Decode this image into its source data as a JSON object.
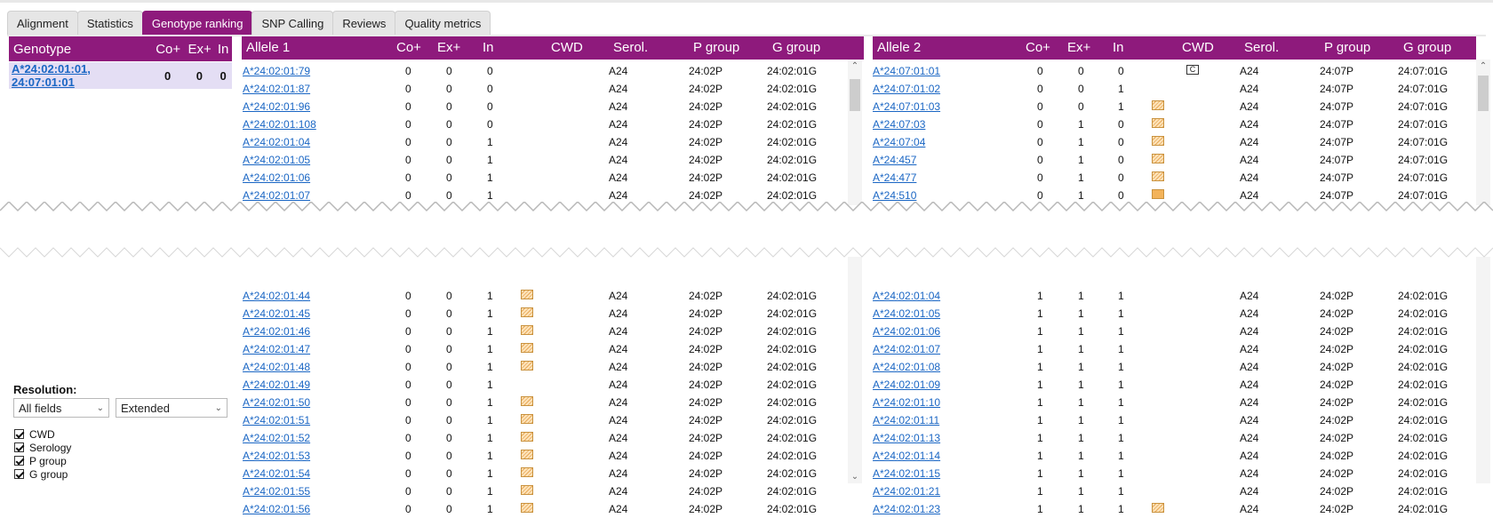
{
  "tabs": [
    "Alignment",
    "Statistics",
    "Genotype ranking",
    "SNP Calling",
    "Reviews",
    "Quality metrics"
  ],
  "active_tab": "Genotype ranking",
  "genotype_panel": {
    "headers": [
      "Genotype",
      "Co+",
      "Ex+",
      "In"
    ],
    "row": {
      "genotype": "A*24:02:01:01, 24:07:01:01",
      "co": "0",
      "ex": "0",
      "in": "0"
    }
  },
  "resolution": {
    "label": "Resolution:",
    "fields_select": "All fields",
    "mode_select": "Extended",
    "checkboxes": [
      "CWD",
      "Serology",
      "P group",
      "G group"
    ]
  },
  "allele1": {
    "headers": [
      "Allele 1",
      "Co+",
      "Ex+",
      "In",
      "CWD",
      "Serol.",
      "P group",
      "G group"
    ],
    "rows_top": [
      {
        "allele": "A*24:02:01:79",
        "co": "0",
        "ex": "0",
        "in": "0",
        "cwd": "",
        "serol": "A24",
        "p": "24:02P",
        "g": "24:02:01G"
      },
      {
        "allele": "A*24:02:01:87",
        "co": "0",
        "ex": "0",
        "in": "0",
        "cwd": "",
        "serol": "A24",
        "p": "24:02P",
        "g": "24:02:01G"
      },
      {
        "allele": "A*24:02:01:96",
        "co": "0",
        "ex": "0",
        "in": "0",
        "cwd": "",
        "serol": "A24",
        "p": "24:02P",
        "g": "24:02:01G"
      },
      {
        "allele": "A*24:02:01:108",
        "co": "0",
        "ex": "0",
        "in": "0",
        "cwd": "",
        "serol": "A24",
        "p": "24:02P",
        "g": "24:02:01G"
      },
      {
        "allele": "A*24:02:01:04",
        "co": "0",
        "ex": "0",
        "in": "1",
        "cwd": "",
        "serol": "A24",
        "p": "24:02P",
        "g": "24:02:01G"
      },
      {
        "allele": "A*24:02:01:05",
        "co": "0",
        "ex": "0",
        "in": "1",
        "cwd": "",
        "serol": "A24",
        "p": "24:02P",
        "g": "24:02:01G"
      },
      {
        "allele": "A*24:02:01:06",
        "co": "0",
        "ex": "0",
        "in": "1",
        "cwd": "",
        "serol": "A24",
        "p": "24:02P",
        "g": "24:02:01G"
      },
      {
        "allele": "A*24:02:01:07",
        "co": "0",
        "ex": "0",
        "in": "1",
        "cwd": "",
        "serol": "A24",
        "p": "24:02P",
        "g": "24:02:01G"
      }
    ],
    "rows_bottom": [
      {
        "allele": "A*24:02:01:44",
        "co": "0",
        "ex": "0",
        "in": "1",
        "cwd": "hatch",
        "serol": "A24",
        "p": "24:02P",
        "g": "24:02:01G"
      },
      {
        "allele": "A*24:02:01:45",
        "co": "0",
        "ex": "0",
        "in": "1",
        "cwd": "hatch",
        "serol": "A24",
        "p": "24:02P",
        "g": "24:02:01G"
      },
      {
        "allele": "A*24:02:01:46",
        "co": "0",
        "ex": "0",
        "in": "1",
        "cwd": "hatch",
        "serol": "A24",
        "p": "24:02P",
        "g": "24:02:01G"
      },
      {
        "allele": "A*24:02:01:47",
        "co": "0",
        "ex": "0",
        "in": "1",
        "cwd": "hatch",
        "serol": "A24",
        "p": "24:02P",
        "g": "24:02:01G"
      },
      {
        "allele": "A*24:02:01:48",
        "co": "0",
        "ex": "0",
        "in": "1",
        "cwd": "hatch",
        "serol": "A24",
        "p": "24:02P",
        "g": "24:02:01G"
      },
      {
        "allele": "A*24:02:01:49",
        "co": "0",
        "ex": "0",
        "in": "1",
        "cwd": "",
        "serol": "A24",
        "p": "24:02P",
        "g": "24:02:01G"
      },
      {
        "allele": "A*24:02:01:50",
        "co": "0",
        "ex": "0",
        "in": "1",
        "cwd": "hatch",
        "serol": "A24",
        "p": "24:02P",
        "g": "24:02:01G"
      },
      {
        "allele": "A*24:02:01:51",
        "co": "0",
        "ex": "0",
        "in": "1",
        "cwd": "hatch",
        "serol": "A24",
        "p": "24:02P",
        "g": "24:02:01G"
      },
      {
        "allele": "A*24:02:01:52",
        "co": "0",
        "ex": "0",
        "in": "1",
        "cwd": "hatch",
        "serol": "A24",
        "p": "24:02P",
        "g": "24:02:01G"
      },
      {
        "allele": "A*24:02:01:53",
        "co": "0",
        "ex": "0",
        "in": "1",
        "cwd": "hatch",
        "serol": "A24",
        "p": "24:02P",
        "g": "24:02:01G"
      },
      {
        "allele": "A*24:02:01:54",
        "co": "0",
        "ex": "0",
        "in": "1",
        "cwd": "hatch",
        "serol": "A24",
        "p": "24:02P",
        "g": "24:02:01G"
      },
      {
        "allele": "A*24:02:01:55",
        "co": "0",
        "ex": "0",
        "in": "1",
        "cwd": "hatch",
        "serol": "A24",
        "p": "24:02P",
        "g": "24:02:01G"
      },
      {
        "allele": "A*24:02:01:56",
        "co": "0",
        "ex": "0",
        "in": "1",
        "cwd": "hatch",
        "serol": "A24",
        "p": "24:02P",
        "g": "24:02:01G"
      }
    ]
  },
  "allele2": {
    "headers": [
      "Allele 2",
      "Co+",
      "Ex+",
      "In",
      "CWD",
      "Serol.",
      "P group",
      "G group"
    ],
    "rows_top": [
      {
        "allele": "A*24:07:01:01",
        "co": "0",
        "ex": "0",
        "in": "0",
        "cwd": "badge",
        "serol": "A24",
        "p": "24:07P",
        "g": "24:07:01G"
      },
      {
        "allele": "A*24:07:01:02",
        "co": "0",
        "ex": "0",
        "in": "1",
        "cwd": "",
        "serol": "A24",
        "p": "24:07P",
        "g": "24:07:01G"
      },
      {
        "allele": "A*24:07:01:03",
        "co": "0",
        "ex": "0",
        "in": "1",
        "cwd": "hatch",
        "serol": "A24",
        "p": "24:07P",
        "g": "24:07:01G"
      },
      {
        "allele": "A*24:07:03",
        "co": "0",
        "ex": "1",
        "in": "0",
        "cwd": "hatch",
        "serol": "A24",
        "p": "24:07P",
        "g": "24:07:01G"
      },
      {
        "allele": "A*24:07:04",
        "co": "0",
        "ex": "1",
        "in": "0",
        "cwd": "hatch",
        "serol": "A24",
        "p": "24:07P",
        "g": "24:07:01G"
      },
      {
        "allele": "A*24:457",
        "co": "0",
        "ex": "1",
        "in": "0",
        "cwd": "hatch",
        "serol": "A24",
        "p": "24:07P",
        "g": "24:07:01G"
      },
      {
        "allele": "A*24:477",
        "co": "0",
        "ex": "1",
        "in": "0",
        "cwd": "hatch",
        "serol": "A24",
        "p": "24:07P",
        "g": "24:07:01G"
      },
      {
        "allele": "A*24:510",
        "co": "0",
        "ex": "1",
        "in": "0",
        "cwd": "solid",
        "serol": "A24",
        "p": "24:07P",
        "g": "24:07:01G"
      }
    ],
    "rows_bottom": [
      {
        "allele": "A*24:02:01:04",
        "co": "1",
        "ex": "1",
        "in": "1",
        "cwd": "",
        "serol": "A24",
        "p": "24:02P",
        "g": "24:02:01G"
      },
      {
        "allele": "A*24:02:01:05",
        "co": "1",
        "ex": "1",
        "in": "1",
        "cwd": "",
        "serol": "A24",
        "p": "24:02P",
        "g": "24:02:01G"
      },
      {
        "allele": "A*24:02:01:06",
        "co": "1",
        "ex": "1",
        "in": "1",
        "cwd": "",
        "serol": "A24",
        "p": "24:02P",
        "g": "24:02:01G"
      },
      {
        "allele": "A*24:02:01:07",
        "co": "1",
        "ex": "1",
        "in": "1",
        "cwd": "",
        "serol": "A24",
        "p": "24:02P",
        "g": "24:02:01G"
      },
      {
        "allele": "A*24:02:01:08",
        "co": "1",
        "ex": "1",
        "in": "1",
        "cwd": "",
        "serol": "A24",
        "p": "24:02P",
        "g": "24:02:01G"
      },
      {
        "allele": "A*24:02:01:09",
        "co": "1",
        "ex": "1",
        "in": "1",
        "cwd": "",
        "serol": "A24",
        "p": "24:02P",
        "g": "24:02:01G"
      },
      {
        "allele": "A*24:02:01:10",
        "co": "1",
        "ex": "1",
        "in": "1",
        "cwd": "",
        "serol": "A24",
        "p": "24:02P",
        "g": "24:02:01G"
      },
      {
        "allele": "A*24:02:01:11",
        "co": "1",
        "ex": "1",
        "in": "1",
        "cwd": "",
        "serol": "A24",
        "p": "24:02P",
        "g": "24:02:01G"
      },
      {
        "allele": "A*24:02:01:13",
        "co": "1",
        "ex": "1",
        "in": "1",
        "cwd": "",
        "serol": "A24",
        "p": "24:02P",
        "g": "24:02:01G"
      },
      {
        "allele": "A*24:02:01:14",
        "co": "1",
        "ex": "1",
        "in": "1",
        "cwd": "",
        "serol": "A24",
        "p": "24:02P",
        "g": "24:02:01G"
      },
      {
        "allele": "A*24:02:01:15",
        "co": "1",
        "ex": "1",
        "in": "1",
        "cwd": "",
        "serol": "A24",
        "p": "24:02P",
        "g": "24:02:01G"
      },
      {
        "allele": "A*24:02:01:21",
        "co": "1",
        "ex": "1",
        "in": "1",
        "cwd": "",
        "serol": "A24",
        "p": "24:02P",
        "g": "24:02:01G"
      },
      {
        "allele": "A*24:02:01:23",
        "co": "1",
        "ex": "1",
        "in": "1",
        "cwd": "hatch",
        "serol": "A24",
        "p": "24:02P",
        "g": "24:02:01G"
      }
    ]
  },
  "colors": {
    "header_bg": "#8e1a7c",
    "selected_row": "#e4def4",
    "link": "#1a66c4",
    "cwd_hatch": "#e8a85a"
  }
}
